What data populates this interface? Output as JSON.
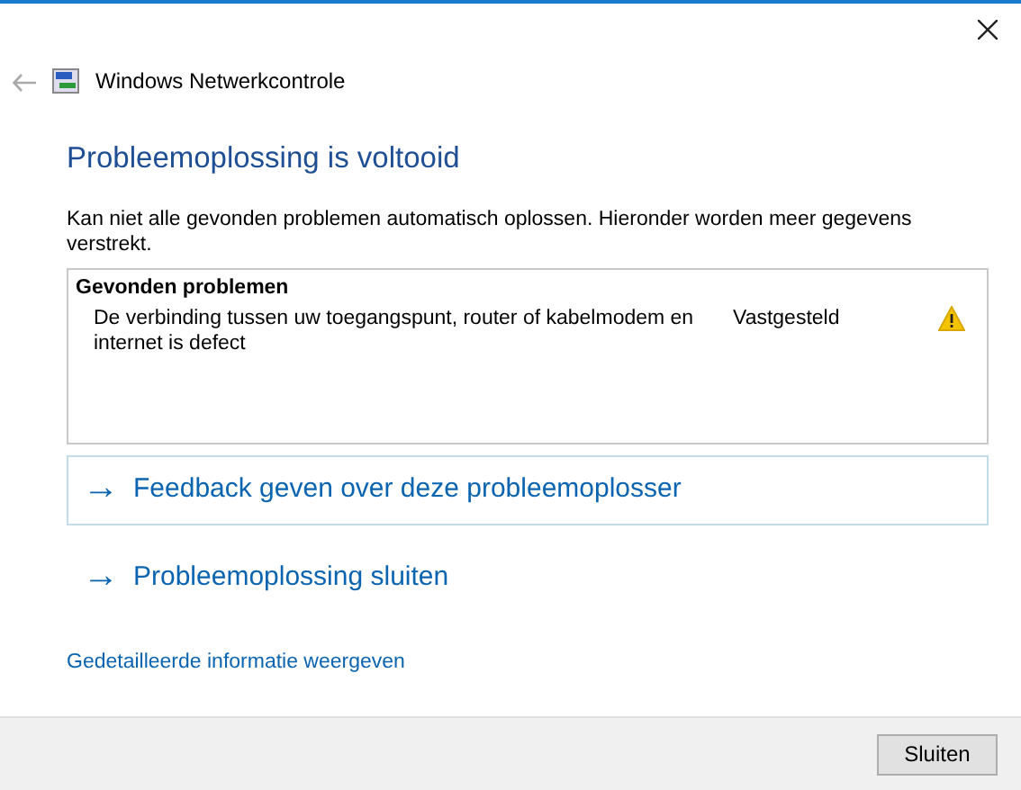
{
  "window": {
    "title": "Windows Netwerkcontrole"
  },
  "heading": "Probleemoplossing is voltooid",
  "description": "Kan niet alle gevonden problemen automatisch oplossen. Hieronder worden meer gegevens verstrekt.",
  "problems": {
    "title": "Gevonden problemen",
    "items": [
      {
        "description": "De verbinding tussen uw toegangspunt, router of kabelmodem en internet is defect",
        "status": "Vastgesteld"
      }
    ]
  },
  "actions": [
    {
      "arrow": "→",
      "label": "Feedback geven over deze probleemoplosser",
      "selected": true
    },
    {
      "arrow": "→",
      "label": "Probleemoplossing sluiten",
      "selected": false
    }
  ],
  "details_link": "Gedetailleerde informatie weergeven",
  "buttons": [
    "Sluiten"
  ]
}
